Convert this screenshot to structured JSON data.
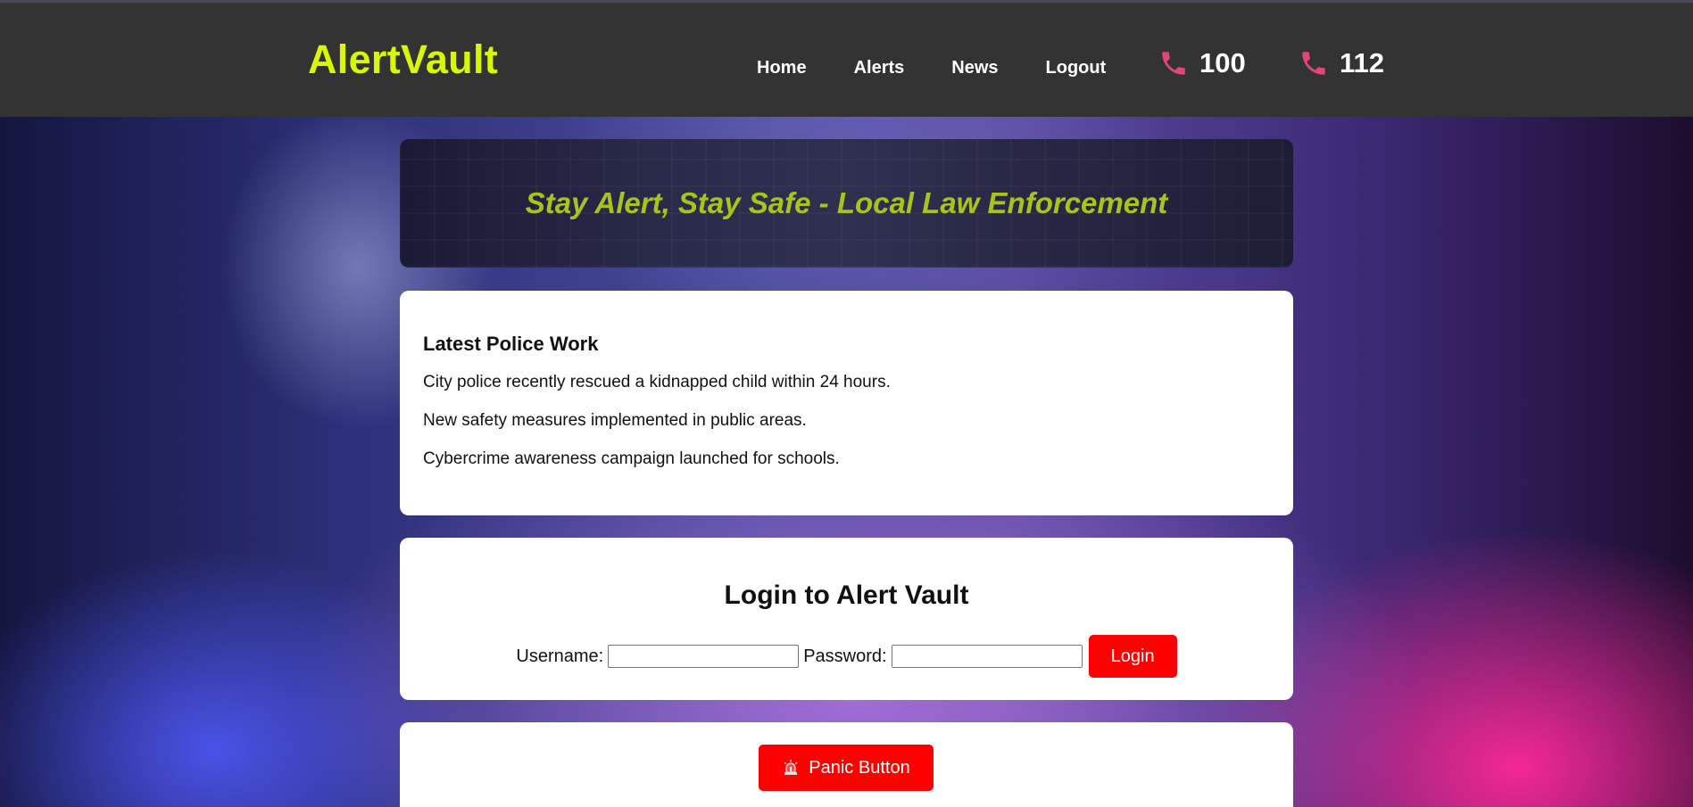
{
  "brand": "AlertVault",
  "nav": {
    "home": "Home",
    "alerts": "Alerts",
    "news": "News",
    "logout": "Logout"
  },
  "emergency_numbers": [
    "100",
    "112"
  ],
  "hero": {
    "tagline": "Stay Alert, Stay Safe - Local Law Enforcement"
  },
  "news_section": {
    "title": "Latest Police Work",
    "items": [
      "City police recently rescued a kidnapped child within 24 hours.",
      "New safety measures implemented in public areas.",
      "Cybercrime awareness campaign launched for schools."
    ]
  },
  "login": {
    "title": "Login to Alert Vault",
    "username_label": "Username:",
    "username_value": "",
    "password_label": "Password:",
    "password_value": "",
    "button": "Login"
  },
  "panic": {
    "button": "Panic Button",
    "icon": "siren-icon"
  },
  "colors": {
    "brand": "#d9f700",
    "tagline": "#a8c41a",
    "header_bg": "#333333",
    "button_red": "#ff0000",
    "phone_icon": "#e0457f"
  }
}
